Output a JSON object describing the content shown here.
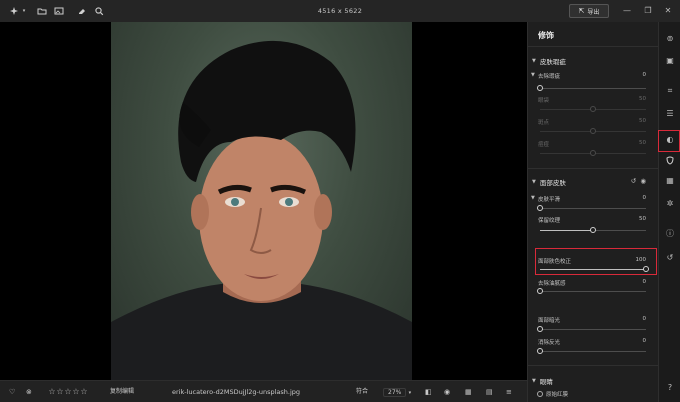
{
  "topbar": {
    "dimensions": "4516 x 5622",
    "export_label": "导出"
  },
  "panel": {
    "title": "修饰",
    "sections": [
      {
        "title": "皮肤瑕疵",
        "sliders": [
          {
            "label": "去除瑕疵",
            "value": "0",
            "level": 0,
            "enabled": true
          },
          {
            "label": "眼袋",
            "value": "50",
            "level": 50,
            "enabled": false
          },
          {
            "label": "斑点",
            "value": "50",
            "level": 50,
            "enabled": false
          },
          {
            "label": "痘痘",
            "value": "50",
            "level": 50,
            "enabled": false
          }
        ]
      },
      {
        "title": "面部皮肤",
        "sliders": [
          {
            "label": "皮肤平滑",
            "value": "0",
            "level": 0,
            "enabled": true
          },
          {
            "label": "保留纹理",
            "value": "50",
            "level": 50,
            "enabled": true
          },
          {
            "label": "面部肤色校正",
            "value": "100",
            "level": 100,
            "enabled": true
          },
          {
            "label": "去除油腻感",
            "value": "0",
            "level": 0,
            "enabled": true
          },
          {
            "label": "面部暗光",
            "value": "0",
            "level": 0,
            "enabled": true
          },
          {
            "label": "消除反光",
            "value": "0",
            "level": 0,
            "enabled": true
          }
        ]
      },
      {
        "title": "眼睛",
        "sliders": []
      }
    ],
    "last_option": "原始红膜"
  },
  "bottombar": {
    "copy_edit": "复制编辑",
    "filename": "erik-lucatero-d2MSDujJl2g-unsplash.jpg",
    "fit": "符合",
    "zoom": "27%"
  },
  "colors": {
    "highlight": "#d92a3a",
    "panel_bg": "#1f1f1f",
    "topbar_bg": "#252525"
  }
}
